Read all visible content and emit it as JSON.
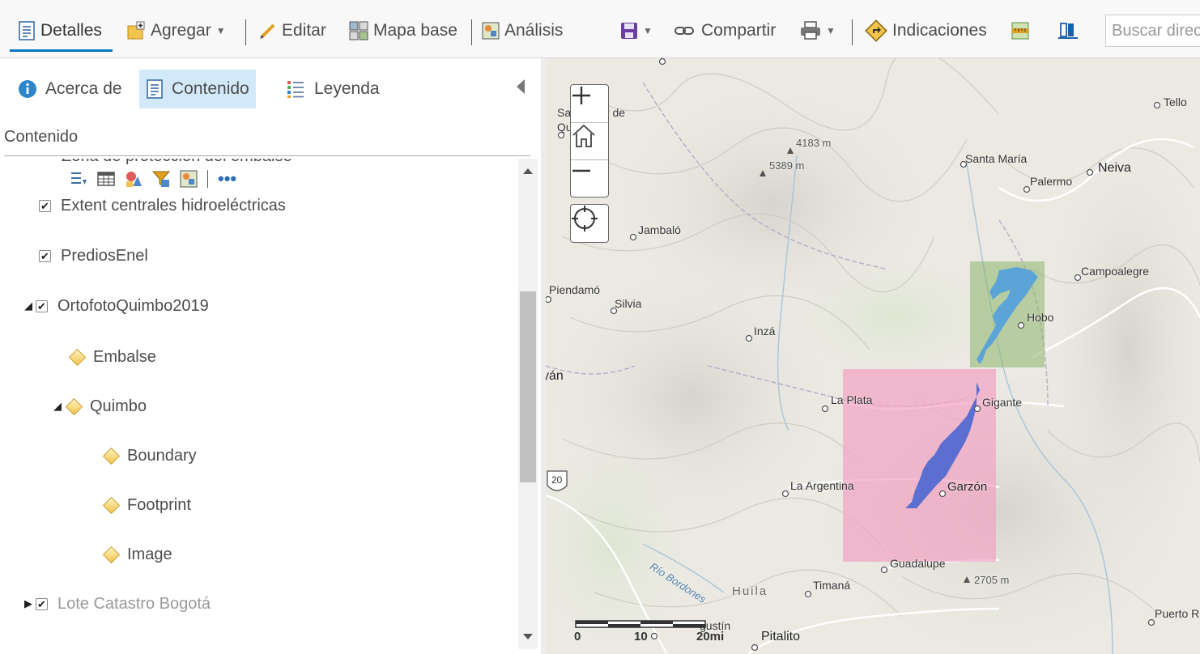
{
  "toolbar": {
    "details": "Detalles",
    "add": "Agregar",
    "edit": "Editar",
    "basemap": "Mapa base",
    "analysis": "Análisis",
    "share": "Compartir",
    "directions": "Indicaciones",
    "search_placeholder": "Buscar direc"
  },
  "panel": {
    "tabs": [
      "Acerca de",
      "Contenido",
      "Leyenda"
    ],
    "section_title": "Contenido",
    "cut_layer": "Zona de protección del embalse",
    "layers": {
      "extent": "Extent centrales hidroeléctricas",
      "predios": "PrediosEnel",
      "orto": "OrtofotoQuimbo2019",
      "embalse": "Embalse",
      "quimbo": "Quimbo",
      "boundary": "Boundary",
      "footprint": "Footprint",
      "image": "Image",
      "lote": "Lote Catastro Bogotá"
    },
    "checkbox_glyph": "✔",
    "expanded_glyph": "◢",
    "collapsed_glyph": "▶"
  },
  "map": {
    "places": [
      "Santander de Quilichao",
      "Santa María",
      "Palermo",
      "Neiva",
      "Tello",
      "Jambaló",
      "Piendamó",
      "Silvia",
      "Inzá",
      "Campoalegre",
      "Hobo",
      "yán",
      "La Plata",
      "Gigante",
      "La Argentina",
      "Garzón",
      "Guadalupe",
      "Timaná",
      "Huila",
      "Pitalito",
      "Puerto R",
      "gustín"
    ],
    "elevations": [
      "4183 m",
      "5389 m",
      "2705 m"
    ],
    "river": "Río Bordones",
    "highway": "20",
    "scale": [
      "0",
      "10",
      "20mi"
    ]
  },
  "colors": {
    "accent": "#0079c1",
    "tab_active_bg": "#d2e9f9",
    "extent_green": "#8db56c",
    "extent_pink": "#f3a3c3",
    "reservoir": "#5b6fd1"
  }
}
